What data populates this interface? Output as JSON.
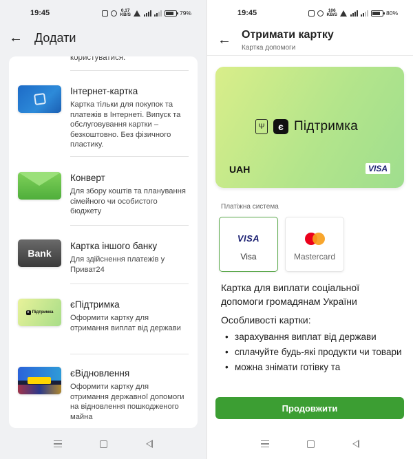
{
  "left": {
    "status": {
      "time": "19:45",
      "netspeed_top": "0.17",
      "netspeed_bottom": "KB/S",
      "battery": "79%"
    },
    "header": {
      "title": "Додати"
    },
    "cutoff_text": "користуватися.",
    "items": [
      {
        "title": "Інтернет-картка",
        "description": "Картка тільки для покупок та платежів в Інтернеті. Випуск та обслуговування картки – безкоштовно. Без фізичного пластику."
      },
      {
        "title": "Конверт",
        "description": "Для збору коштів та планування сімейного чи особистого бюджету"
      },
      {
        "title": "Картка іншого банку",
        "description": "Для здійснення платежів у Приват24",
        "thumb_text": "Bank"
      },
      {
        "title": "єПідтримка",
        "description": "Оформити картку для отримання виплат від держави",
        "thumb_text": "Підтримка",
        "thumb_e": "є"
      },
      {
        "title": "єВідновлення",
        "description": "Оформити картку для отримання державної допомоги на відновлення пошкодженого майна"
      }
    ]
  },
  "right": {
    "status": {
      "time": "19:45",
      "netspeed_top": "106",
      "netspeed_bottom": "KB/S",
      "battery": "80%"
    },
    "header": {
      "title": "Отримати картку",
      "subtitle": "Картка допомоги"
    },
    "card": {
      "e_letter": "є",
      "brand": "Підтримка",
      "currency": "UAH",
      "network": "VISA"
    },
    "payment_label": "Платіжна система",
    "payment_options": [
      {
        "logo": "VISA",
        "label": "Visa",
        "selected": true
      },
      {
        "label": "Mastercard",
        "selected": false
      }
    ],
    "description": "Картка для виплати соціальної допомоги громадянам України",
    "features_title": "Особливості картки:",
    "features": [
      "зарахування виплат від держави",
      "сплачуйте будь-які продукти чи товари",
      "можна знімати готівку та"
    ],
    "cta_label": "Продовжити"
  },
  "colors": {
    "accent_green": "#3c9e33",
    "selected_border": "#5aa84a",
    "left_bg": "#f0f1f3"
  }
}
